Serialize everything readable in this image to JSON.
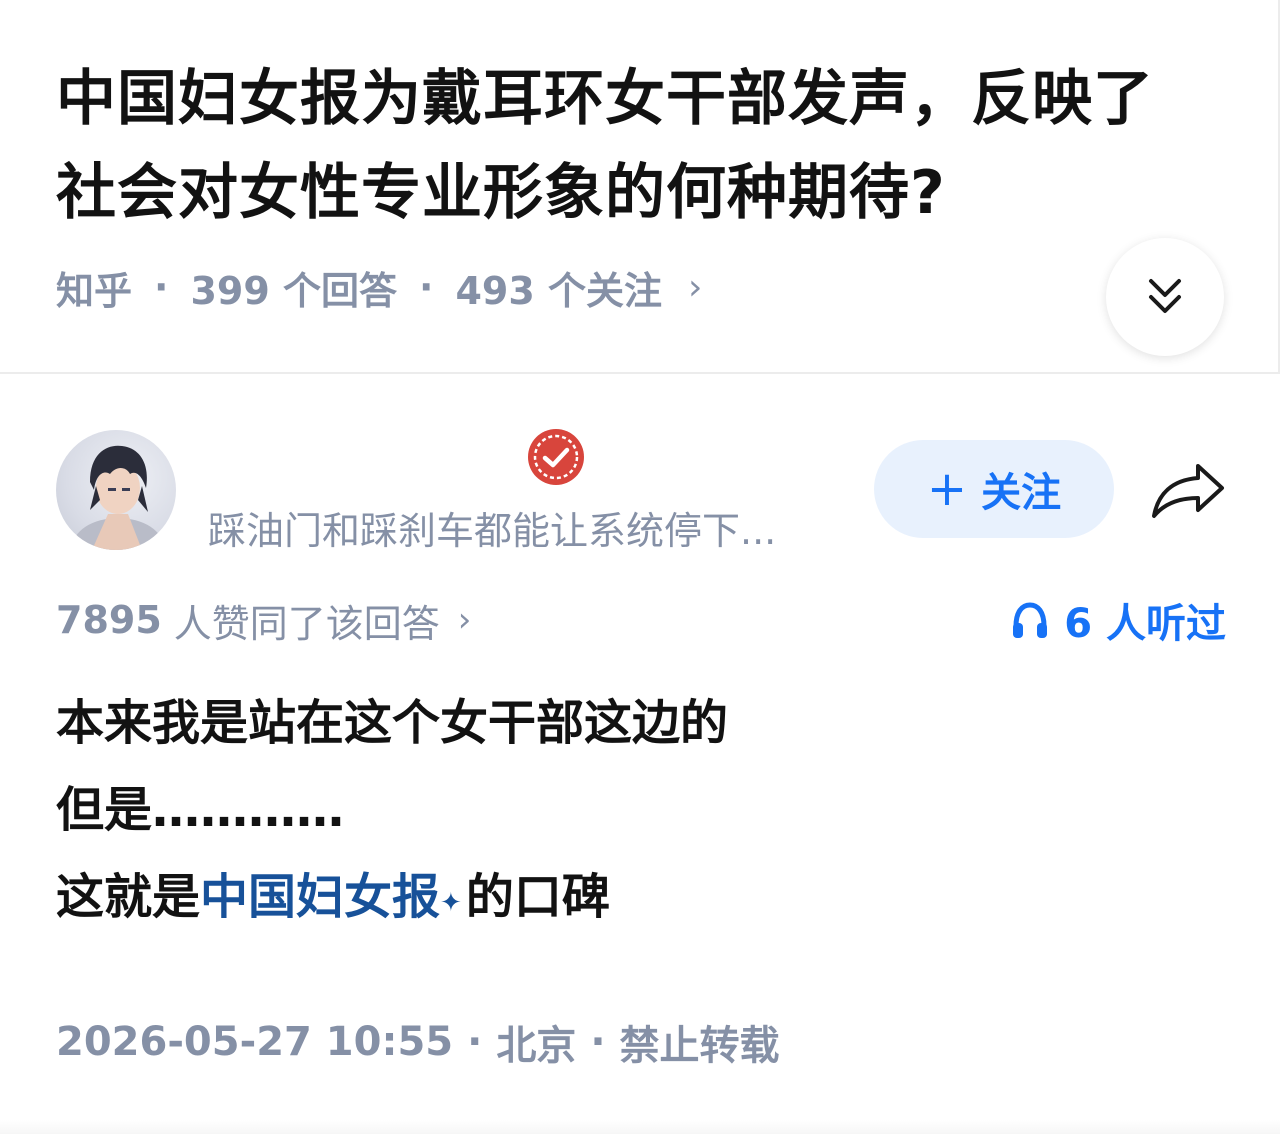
{
  "question": {
    "title": "中国妇女报为戴耳环女干部发声，反映了社会对女性专业形象的何种期待?",
    "source": "知乎",
    "answers": "399 个回答",
    "follows": "493 个关注"
  },
  "answer": {
    "author_name": "踩油门和踩刹车都能让系统停下...",
    "follow_label": "关注",
    "votes_count": "7895",
    "votes_text": "人赞同了该回答",
    "listen_text": "6 人听过",
    "lines": [
      "本来我是站在这个女干部这边的",
      "但是…………",
      "这就是"
    ],
    "link_text": "中国妇女报",
    "line3_suffix": "的口碑",
    "timestamp": "2026-05-27 10:55",
    "location": "北京",
    "copyright": "禁止转载"
  },
  "colors": {
    "accent": "#1772f6",
    "link": "#175199",
    "muted": "#8590a6",
    "badge": "#d8453c"
  },
  "icons": [
    "chevron-double-down-icon",
    "verified-badge-icon",
    "plus-icon",
    "share-icon",
    "headphones-icon",
    "sparkle-icon",
    "chevron-right-icon"
  ]
}
